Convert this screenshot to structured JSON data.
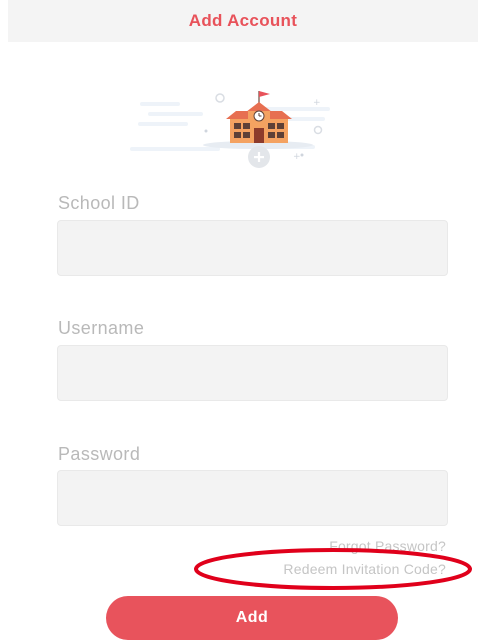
{
  "header": {
    "title": "Add Account"
  },
  "form": {
    "school_id": {
      "label": "School ID",
      "value": "",
      "placeholder": ""
    },
    "username": {
      "label": "Username",
      "value": "",
      "placeholder": ""
    },
    "password": {
      "label": "Password",
      "value": "",
      "placeholder": ""
    }
  },
  "links": {
    "forgot_password": "Forgot Password?",
    "redeem_code": "Redeem Invitation Code?"
  },
  "actions": {
    "add_label": "Add"
  },
  "illustration": {
    "icon": "school-building-icon",
    "add_icon": "plus-icon"
  },
  "colors": {
    "accent": "#e8525a",
    "header_bg": "#f4f4f4",
    "input_bg": "#f3f3f3",
    "label": "#b9b9b9",
    "annotation": "#e0001b"
  }
}
